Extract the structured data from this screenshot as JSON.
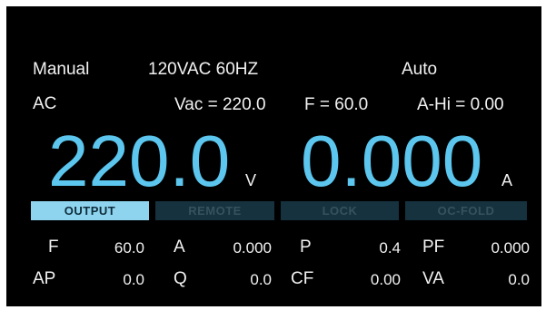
{
  "header": {
    "mode": "Manual",
    "setting": "120VAC 60HZ",
    "range": "Auto",
    "output_type": "AC",
    "vac_setpoint": "Vac = 220.0",
    "freq_setpoint": "F = 60.0",
    "ahi_setpoint": "A-Hi = 0.00"
  },
  "readout": {
    "voltage": "220.0",
    "voltage_unit": "V",
    "current": "0.000",
    "current_unit": "A"
  },
  "status": [
    {
      "label": "OUTPUT",
      "active": true
    },
    {
      "label": "REMOTE",
      "active": false
    },
    {
      "label": "LOCK",
      "active": false
    },
    {
      "label": "OC-FOLD",
      "active": false
    }
  ],
  "measurements": {
    "row1": [
      {
        "label": "F",
        "value": "60.0"
      },
      {
        "label": "A",
        "value": "0.000"
      },
      {
        "label": "P",
        "value": "0.4"
      },
      {
        "label": "PF",
        "value": "0.000"
      }
    ],
    "row2": [
      {
        "label": "AP",
        "value": "0.0"
      },
      {
        "label": "Q",
        "value": "0.0"
      },
      {
        "label": "CF",
        "value": "0.00"
      },
      {
        "label": "VA",
        "value": "0.0"
      }
    ]
  },
  "colors": {
    "background": "#000000",
    "readout": "#5cc6ee",
    "status_active": "#8fd4ef",
    "status_inactive": "#15323e"
  }
}
